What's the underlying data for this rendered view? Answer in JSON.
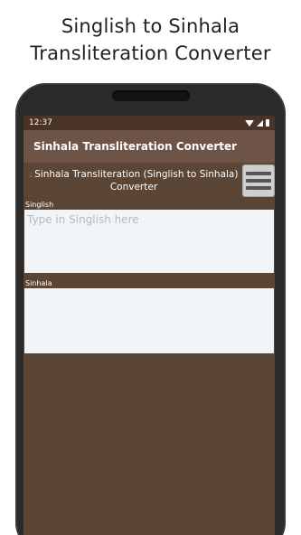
{
  "promo": {
    "line1": "Singlish to Sinhala",
    "line2": "Transliteration Converter"
  },
  "status_bar": {
    "time": "12:37",
    "icons": [
      "wifi-icon",
      "signal-icon",
      "battery-icon"
    ]
  },
  "app_bar": {
    "title": "Sinhala Transliteration Converter"
  },
  "header": {
    "icon": "drop-icon",
    "text": "Sinhala Transliteration (Singlish to Sinhala) Converter",
    "menu_icon": "hamburger-menu-icon"
  },
  "singlish_field": {
    "label": "Singlish",
    "placeholder": "Type in Singlish here",
    "value": ""
  },
  "sinhala_field": {
    "label": "Sinhala",
    "value": ""
  },
  "colors": {
    "app_background": "#5b4535",
    "app_bar": "#6e5446",
    "status_bar": "#4a3428",
    "field_background": "#f2f5f7",
    "drop_icon": "#5fb2ff"
  }
}
